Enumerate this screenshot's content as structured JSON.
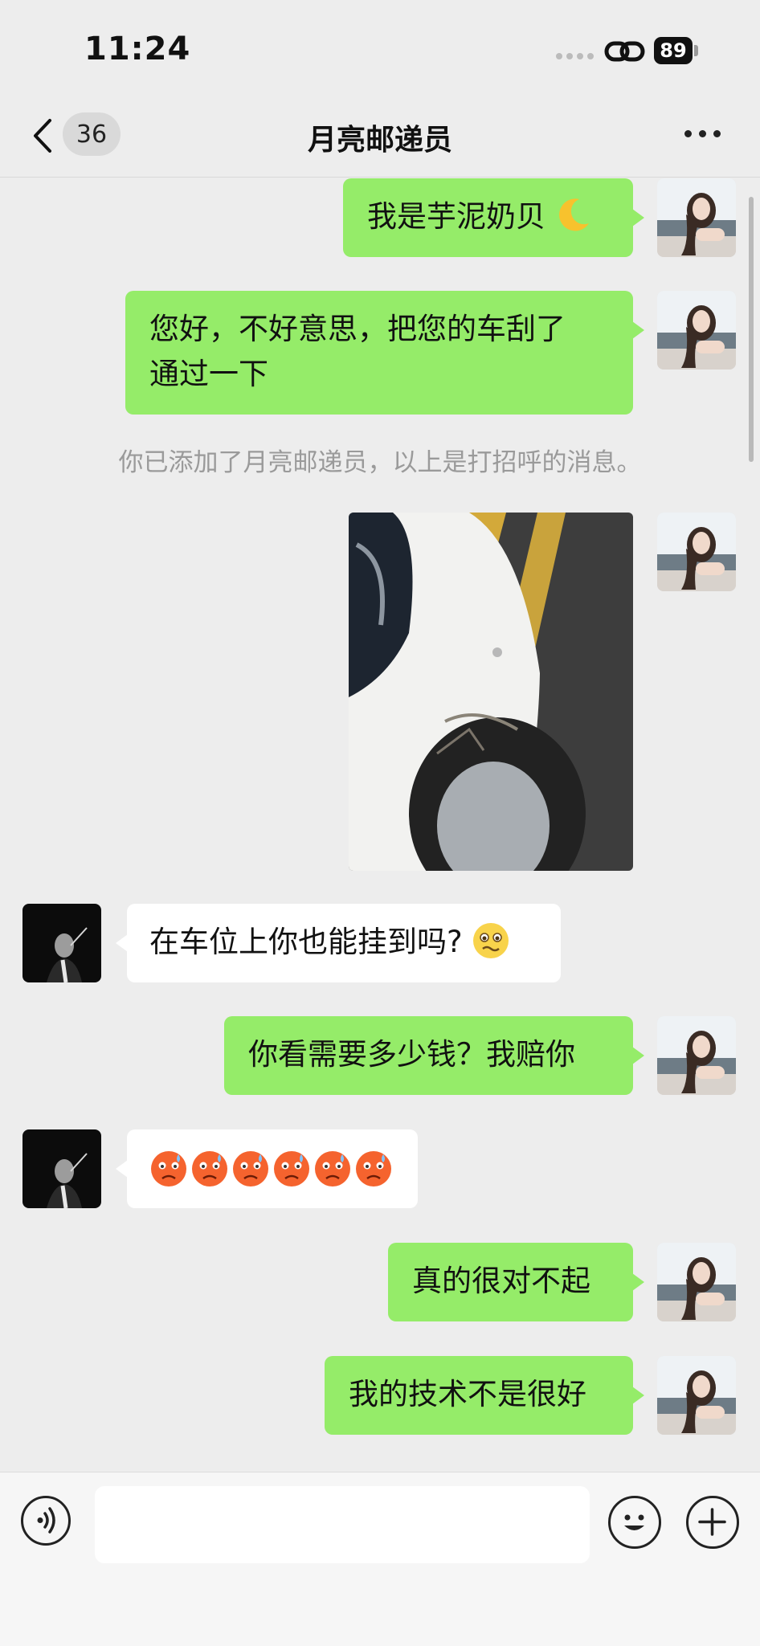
{
  "status_bar": {
    "time": "11:24",
    "battery": "89"
  },
  "nav": {
    "back_icon": "chevron-left-icon",
    "unread_count": "36",
    "title": "月亮邮递员",
    "more_icon": "more-dots-icon"
  },
  "messages": [
    {
      "side": "me",
      "text": "我是芋泥奶贝"
    },
    {
      "side": "me",
      "text_line1": "您好，不好意思，把您的车刮了",
      "text_line2": "通过一下"
    },
    {
      "side": "system",
      "text": "你已添加了月亮邮递员，以上是打招呼的消息。"
    },
    {
      "side": "me",
      "type": "image",
      "icon": "car-scratch-photo"
    },
    {
      "side": "them",
      "text": "在车位上你也能挂到吗?"
    },
    {
      "side": "me",
      "text": "你看需要多少钱？我赔你"
    },
    {
      "side": "them",
      "type": "emoji-row",
      "icon": "sad-face-emoji"
    },
    {
      "side": "me",
      "text": "真的很对不起"
    },
    {
      "side": "me",
      "text": "我的技术不是很好"
    }
  ],
  "input_bar": {
    "voice_icon": "voice-icon",
    "emoji_icon": "smile-icon",
    "plus_icon": "plus-icon",
    "placeholder": ""
  },
  "colors": {
    "my_bubble": "#95ec69",
    "their_bubble": "#ffffff",
    "background": "#ededed"
  }
}
